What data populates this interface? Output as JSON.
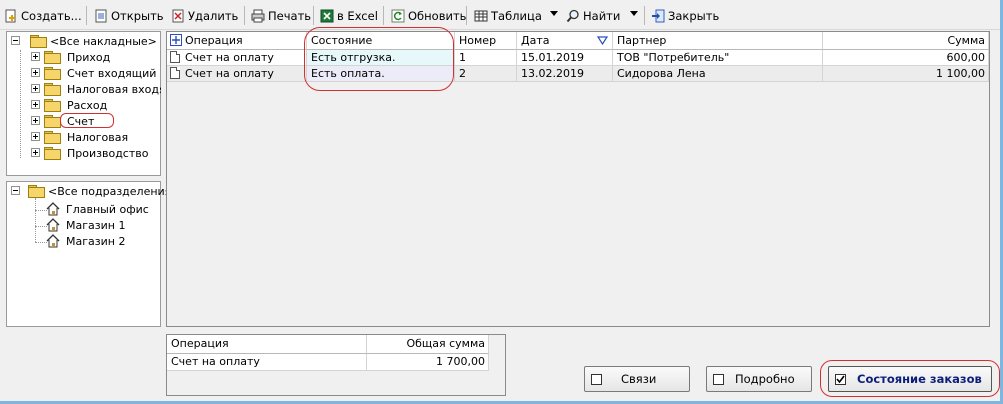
{
  "toolbar": {
    "create": "Создать...",
    "open": "Открыть",
    "delete": "Удалить",
    "print": "Печать",
    "excel": "в Excel",
    "refresh": "Обновить",
    "table": "Таблица",
    "find": "Найти",
    "close": "Закрыть"
  },
  "tree_docs": {
    "root": "<Все накладные>",
    "items": [
      "Приход",
      "Счет входящий",
      "Налоговая входящ",
      "Расход",
      "Счет",
      "Налоговая",
      "Производство"
    ]
  },
  "tree_depts": {
    "root": "<Все подразделения>",
    "items": [
      "Главный офис",
      "Магазин 1",
      "Магазин 2"
    ]
  },
  "grid": {
    "headers": {
      "operation": "Операция",
      "state": "Состояние",
      "number": "Номер",
      "date": "Дата",
      "partner": "Партнер",
      "sum": "Сумма"
    },
    "rows": [
      {
        "operation": "Счет на оплату",
        "state": "Есть отгрузка.",
        "number": "1",
        "date": "15.01.2019",
        "partner": "ТОВ \"Потребитель\"",
        "sum": "600,00"
      },
      {
        "operation": "Счет на оплату",
        "state": "Есть оплата.",
        "number": "2",
        "date": "13.02.2019",
        "partner": "Сидорова Лена",
        "sum": "1 100,00"
      }
    ]
  },
  "summary": {
    "headers": {
      "operation": "Операция",
      "total": "Общая сумма"
    },
    "rows": [
      {
        "operation": "Счет на оплату",
        "total": "1 700,00"
      }
    ]
  },
  "buttons": {
    "links": "Связи",
    "details": "Подробно",
    "order_state": "Состояние заказов"
  },
  "colors": {
    "highlight_red": "#d03030",
    "row1_state_bg": "#e6f8fa",
    "row2_state_bg": "#ecebf8",
    "accent_blue": "#0033cc"
  }
}
